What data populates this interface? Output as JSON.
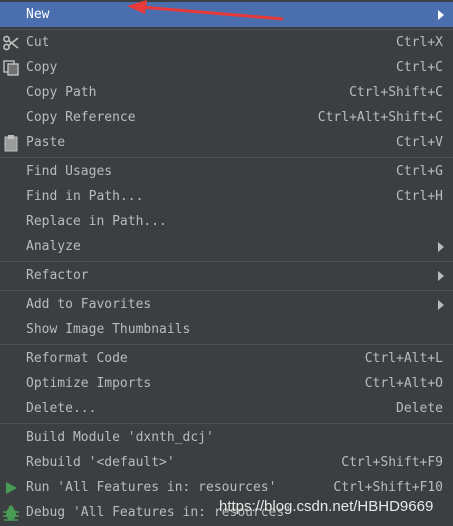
{
  "context_menu": {
    "items": [
      {
        "label": "New",
        "shortcut": "",
        "icon": "",
        "submenu": true,
        "selected": true
      },
      {
        "label": "Cut",
        "shortcut": "Ctrl+X",
        "icon": "scissors-icon",
        "submenu": false
      },
      {
        "label": "Copy",
        "shortcut": "Ctrl+C",
        "icon": "copy-icon",
        "submenu": false
      },
      {
        "label": "Copy Path",
        "shortcut": "Ctrl+Shift+C",
        "icon": "",
        "submenu": false
      },
      {
        "label": "Copy Reference",
        "shortcut": "Ctrl+Alt+Shift+C",
        "icon": "",
        "submenu": false
      },
      {
        "label": "Paste",
        "shortcut": "Ctrl+V",
        "icon": "clipboard-icon",
        "submenu": false
      },
      {
        "label": "Find Usages",
        "shortcut": "Ctrl+G",
        "icon": "",
        "submenu": false
      },
      {
        "label": "Find in Path...",
        "shortcut": "Ctrl+H",
        "icon": "",
        "submenu": false
      },
      {
        "label": "Replace in Path...",
        "shortcut": "",
        "icon": "",
        "submenu": false
      },
      {
        "label": "Analyze",
        "shortcut": "",
        "icon": "",
        "submenu": true
      },
      {
        "label": "Refactor",
        "shortcut": "",
        "icon": "",
        "submenu": true
      },
      {
        "label": "Add to Favorites",
        "shortcut": "",
        "icon": "",
        "submenu": true
      },
      {
        "label": "Show Image Thumbnails",
        "shortcut": "",
        "icon": "",
        "submenu": false
      },
      {
        "label": "Reformat Code",
        "shortcut": "Ctrl+Alt+L",
        "icon": "",
        "submenu": false
      },
      {
        "label": "Optimize Imports",
        "shortcut": "Ctrl+Alt+O",
        "icon": "",
        "submenu": false
      },
      {
        "label": "Delete...",
        "shortcut": "Delete",
        "icon": "",
        "submenu": false
      },
      {
        "label": "Build Module 'dxnth_dcj'",
        "shortcut": "",
        "icon": "",
        "submenu": false
      },
      {
        "label": "Rebuild '<default>'",
        "shortcut": "Ctrl+Shift+F9",
        "icon": "",
        "submenu": false
      },
      {
        "label": "Run 'All Features in: resources'",
        "shortcut": "Ctrl+Shift+F10",
        "icon": "run-icon",
        "submenu": false
      },
      {
        "label": "Debug 'All Features in: resources'",
        "shortcut": "",
        "icon": "debug-icon",
        "submenu": false
      }
    ]
  },
  "annotation": {
    "arrow_color": "#e83a3a"
  },
  "watermark": "https://blog.csdn.net/HBHD9669",
  "colors": {
    "menu_bg": "#3c3f41",
    "selected_bg": "#4b6eaf",
    "text": "#bbbbbb",
    "separator": "#515151"
  }
}
